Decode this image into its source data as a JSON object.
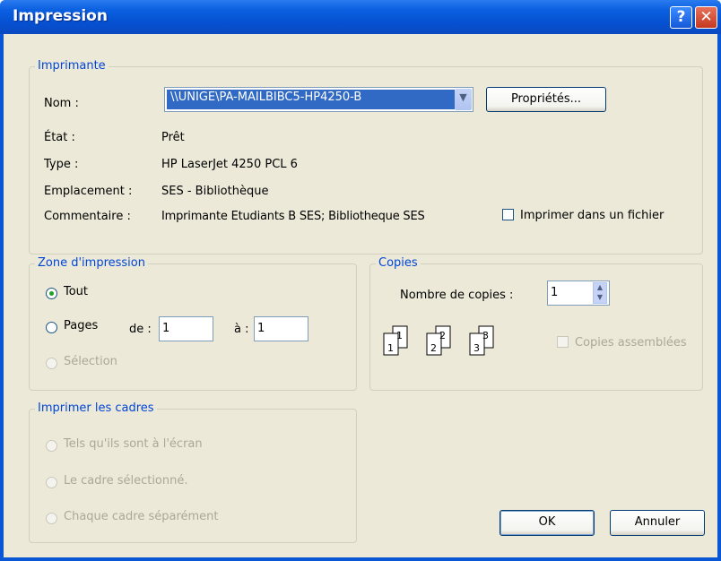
{
  "window": {
    "title": "Impression"
  },
  "imprimante": {
    "legend": "Imprimante",
    "nom_label": "Nom :",
    "nom_value": "\\\\UNIGE\\PA-MAILBIBC5-HP4250-B",
    "proprietes_label": "Propriétés...",
    "etat_label": "État :",
    "etat_value": "Prêt",
    "type_label": "Type :",
    "type_value": "HP LaserJet 4250 PCL 6",
    "emplacement_label": "Emplacement :",
    "emplacement_value": "SES - Bibliothèque",
    "commentaire_label": "Commentaire :",
    "commentaire_value": "Imprimante Etudiants  B  SES; Bibliotheque SES",
    "fichier_label": "Imprimer dans un fichier"
  },
  "zone": {
    "legend": "Zone d'impression",
    "tout_label": "Tout",
    "pages_label": "Pages",
    "de_label": "de :",
    "de_value": "1",
    "a_label": "à :",
    "a_value": "1",
    "selection_label": "Sélection"
  },
  "copies": {
    "legend": "Copies",
    "nombre_label": "Nombre de copies :",
    "nombre_value": "1",
    "assemblees_label": "Copies assemblées",
    "collate_pages": [
      "1",
      "1",
      "2",
      "2",
      "3",
      "3"
    ]
  },
  "cadres": {
    "legend": "Imprimer les cadres",
    "option1": "Tels qu'ils sont à l'écran",
    "option2": "Le cadre sélectionné.",
    "option3": "Chaque cadre séparément"
  },
  "buttons": {
    "ok": "OK",
    "annuler": "Annuler"
  },
  "icons": {
    "help": "?",
    "close": "✕",
    "dropdown": "▼",
    "spin_up": "▲",
    "spin_down": "▼"
  },
  "colors": {
    "titlebar": "#0a5fe0",
    "legend": "#0046d5",
    "selection": "#316ac5",
    "face": "#ece9d8"
  }
}
